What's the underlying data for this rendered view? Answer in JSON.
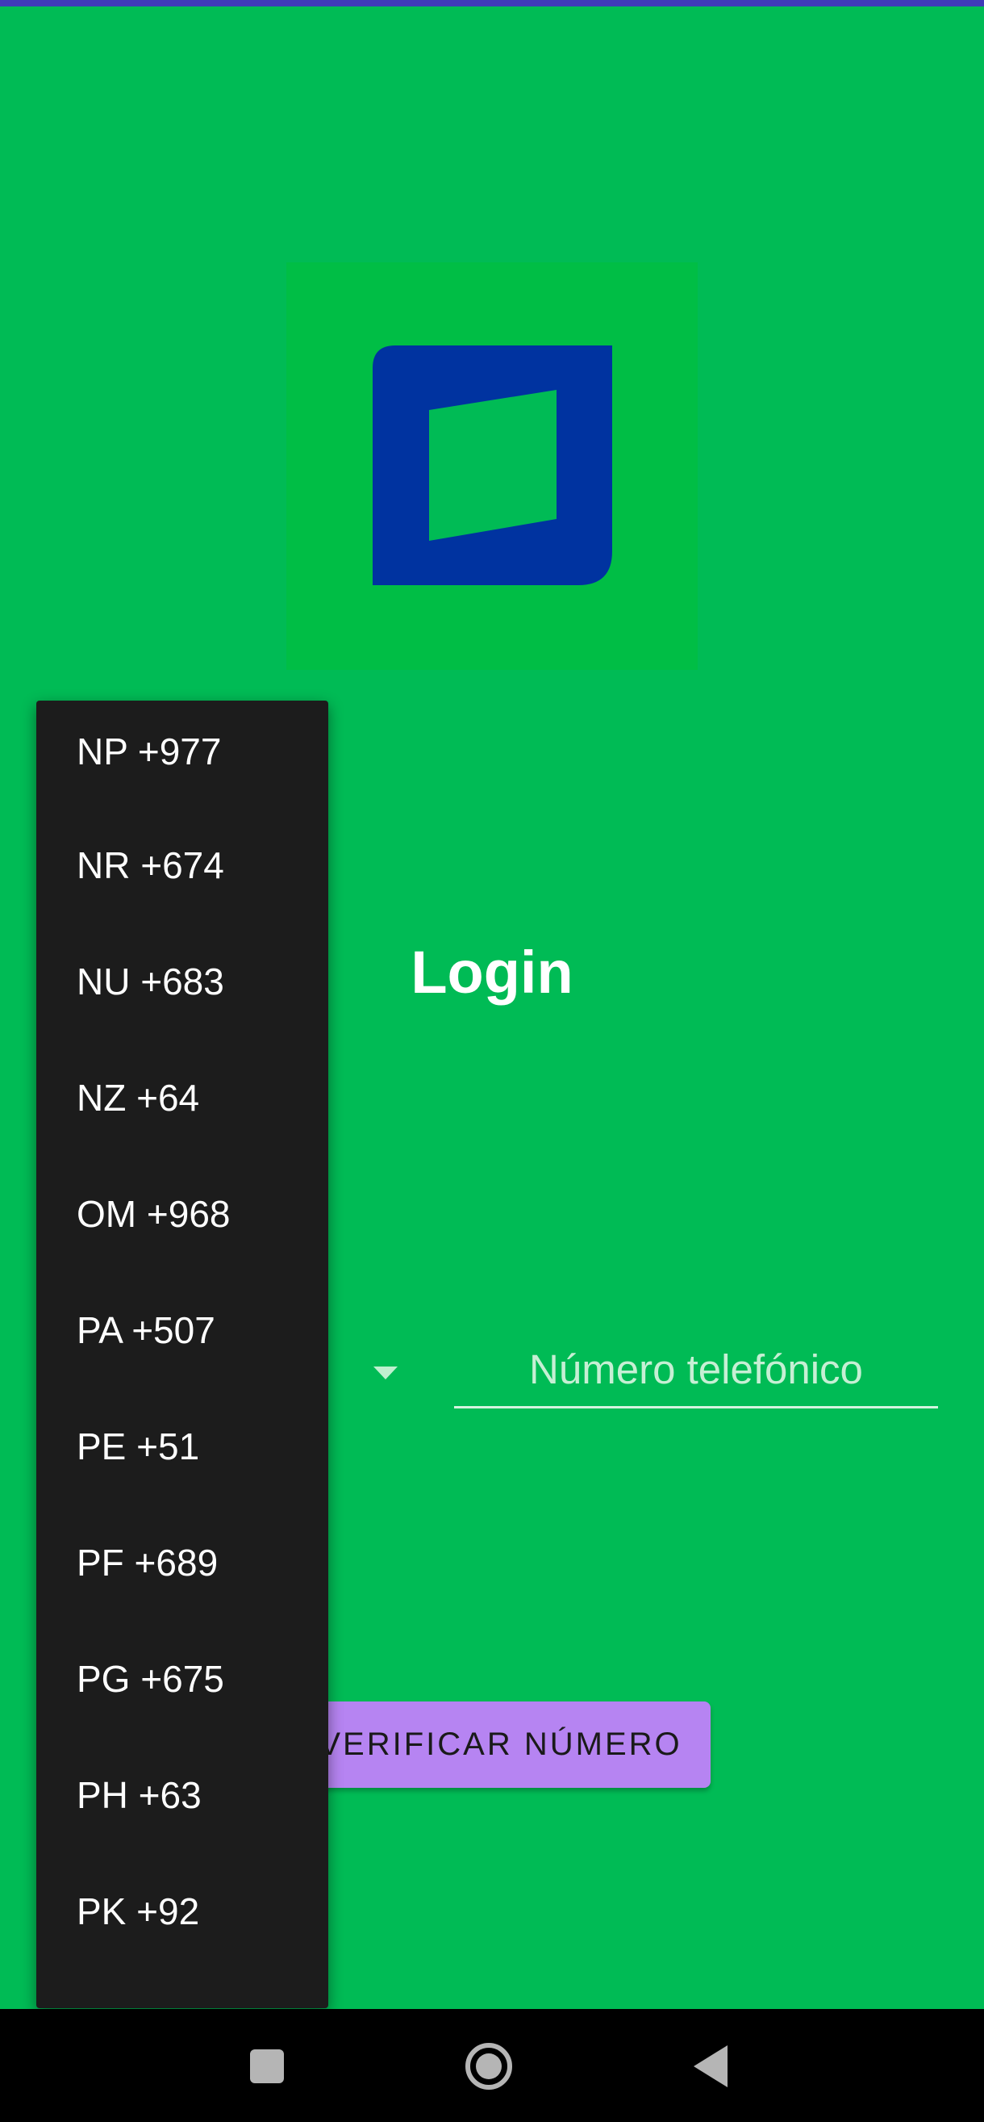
{
  "screen": {
    "title": "Login",
    "phone_placeholder": "Número telefónico",
    "verify_button_label": "VERIFICAR NÚMERO"
  },
  "country_menu": {
    "items": [
      {
        "label": "NP +977"
      },
      {
        "label": "NR +674"
      },
      {
        "label": "NU +683"
      },
      {
        "label": "NZ +64"
      },
      {
        "label": "OM +968"
      },
      {
        "label": "PA +507"
      },
      {
        "label": "PE +51"
      },
      {
        "label": "PF +689"
      },
      {
        "label": "PG +675"
      },
      {
        "label": "PH +63"
      },
      {
        "label": "PK +92"
      }
    ]
  },
  "icons": {
    "logo": "app-logo-icon",
    "dropdown": "dropdown-arrow-icon",
    "nav_recents": "recents-square-icon",
    "nav_home": "home-circle-icon",
    "nav_back": "back-triangle-icon"
  },
  "colors": {
    "background": "#00bb55",
    "logo_blue": "#0033a0",
    "button": "#b684f2",
    "menu_background": "#1c1c1c",
    "status_strip": "#3f3ab8"
  }
}
